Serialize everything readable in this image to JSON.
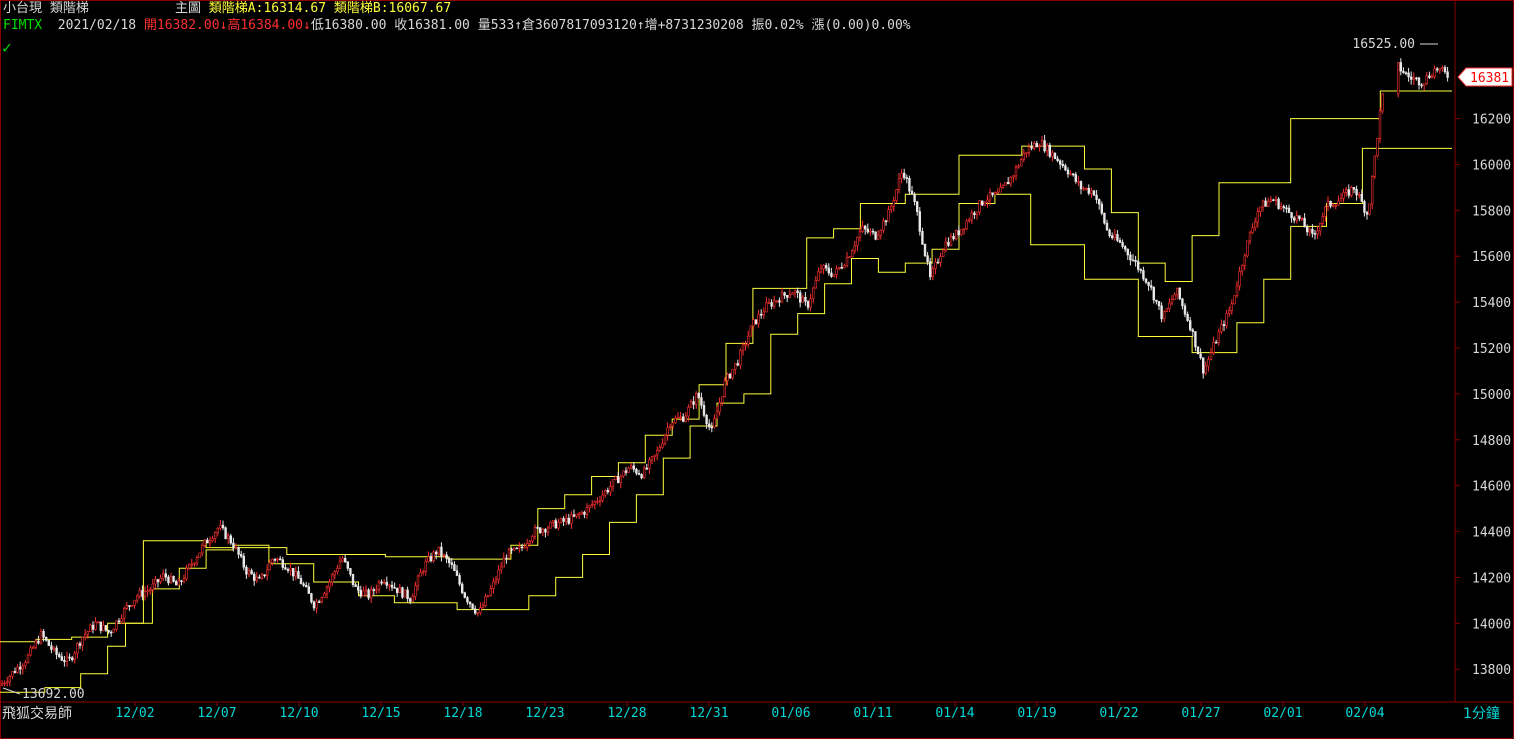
{
  "header": {
    "instrument": "小台現",
    "indicator": "類階梯",
    "pane": "主圖",
    "ladderA": "類階梯A:16314.67",
    "ladderB": "類階梯B:16067.67"
  },
  "quote": {
    "symbol": "FIMTX",
    "date": "2021/02/18",
    "open": "開16382.00",
    "open_arrow": "↓",
    "high": "高16384.00",
    "high_arrow": "↓",
    "low": "低16380.00",
    "close": "收16381.00",
    "volume": "量533",
    "oi_arrow": "↑",
    "open_interest": "倉3607817093120",
    "change_arrow": "↑",
    "change": "增+8731230208",
    "amplitude": "振0.02%",
    "rise": "漲(0.00)0.00%"
  },
  "footer": {
    "vendor": "飛狐交易師",
    "period": "1分鐘"
  },
  "colors": {
    "background": "#000000",
    "border": "#8b0000",
    "ladder": "#ffff3c",
    "candle_up": "#ff3030",
    "candle_down": "#e8e8e8",
    "axis_text": "#00d8d8"
  },
  "chart_data": {
    "type": "candlestick",
    "ylim": [
      13650,
      16650
    ],
    "yticks": [
      "13800",
      "14000",
      "14200",
      "14400",
      "14600",
      "14800",
      "15000",
      "15200",
      "15400",
      "15600",
      "15800",
      "16000",
      "16200"
    ],
    "xticks": [
      "12/02",
      "12/07",
      "12/10",
      "12/15",
      "12/18",
      "12/23",
      "12/28",
      "12/31",
      "01/06",
      "01/11",
      "01/14",
      "01/19",
      "01/22",
      "01/27",
      "02/01",
      "02/04"
    ],
    "last_price": "16381",
    "high_label": "16525.00",
    "low_label": "13692.00",
    "price_path": [
      13730,
      13790,
      13850,
      13950,
      13870,
      13830,
      13940,
      14000,
      13960,
      14050,
      14120,
      14150,
      14210,
      14160,
      14260,
      14350,
      14420,
      14350,
      14230,
      14180,
      14290,
      14250,
      14180,
      14080,
      14170,
      14290,
      14150,
      14120,
      14200,
      14150,
      14110,
      14250,
      14320,
      14250,
      14120,
      14040,
      14160,
      14300,
      14320,
      14400,
      14420,
      14440,
      14460,
      14500,
      14560,
      14620,
      14680,
      14650,
      14740,
      14880,
      14900,
      15000,
      14830,
      15050,
      15150,
      15300,
      15380,
      15420,
      15450,
      15380,
      15550,
      15520,
      15600,
      15720,
      15690,
      15790,
      15980,
      15800,
      15500,
      15650,
      15700,
      15780,
      15850,
      15870,
      15950,
      16060,
      16100,
      16040,
      15980,
      15900,
      15880,
      15700,
      15650,
      15570,
      15480,
      15330,
      15450,
      15300,
      15100,
      15250,
      15380,
      15620,
      15810,
      15850,
      15800,
      15760,
      15680,
      15820,
      15850,
      15900,
      15780,
      16280,
      16440,
      16380,
      16360,
      16420,
      16381
    ],
    "ladder_A": [
      [
        0,
        13920
      ],
      [
        4,
        13920
      ],
      [
        4,
        13930
      ],
      [
        8,
        13930
      ],
      [
        8,
        13940
      ],
      [
        12,
        13940
      ],
      [
        12,
        14000
      ],
      [
        16,
        14000
      ],
      [
        16,
        14360
      ],
      [
        23,
        14360
      ],
      [
        23,
        14330
      ],
      [
        32,
        14330
      ],
      [
        32,
        14300
      ],
      [
        43,
        14300
      ],
      [
        43,
        14290
      ],
      [
        50,
        14290
      ],
      [
        50,
        14280
      ],
      [
        57,
        14280
      ],
      [
        57,
        14340
      ],
      [
        60,
        14340
      ],
      [
        60,
        14500
      ],
      [
        63,
        14500
      ],
      [
        63,
        14560
      ],
      [
        66,
        14560
      ],
      [
        66,
        14640
      ],
      [
        69,
        14640
      ],
      [
        69,
        14700
      ],
      [
        72,
        14700
      ],
      [
        72,
        14820
      ],
      [
        75,
        14820
      ],
      [
        75,
        14890
      ],
      [
        78,
        14890
      ],
      [
        78,
        15040
      ],
      [
        81,
        15040
      ],
      [
        81,
        15220
      ],
      [
        84,
        15220
      ],
      [
        84,
        15460
      ],
      [
        90,
        15460
      ],
      [
        90,
        15680
      ],
      [
        93,
        15680
      ],
      [
        93,
        15720
      ],
      [
        96,
        15720
      ],
      [
        96,
        15830
      ],
      [
        101,
        15830
      ],
      [
        101,
        15870
      ],
      [
        107,
        15870
      ],
      [
        107,
        16040
      ],
      [
        114,
        16040
      ],
      [
        114,
        16080
      ],
      [
        121,
        16080
      ],
      [
        121,
        15980
      ],
      [
        124,
        15980
      ],
      [
        124,
        15790
      ],
      [
        127,
        15790
      ],
      [
        127,
        15570
      ],
      [
        130,
        15570
      ],
      [
        130,
        15490
      ],
      [
        133,
        15490
      ],
      [
        133,
        15690
      ],
      [
        136,
        15690
      ],
      [
        136,
        15920
      ],
      [
        144,
        15920
      ],
      [
        144,
        16200
      ],
      [
        154,
        16200
      ],
      [
        154,
        16320
      ],
      [
        162,
        16320
      ]
    ],
    "ladder_B": [
      [
        0,
        13700
      ],
      [
        5,
        13700
      ],
      [
        5,
        13720
      ],
      [
        9,
        13720
      ],
      [
        9,
        13780
      ],
      [
        12,
        13780
      ],
      [
        12,
        13900
      ],
      [
        14,
        13900
      ],
      [
        14,
        14000
      ],
      [
        17,
        14000
      ],
      [
        17,
        14150
      ],
      [
        20,
        14150
      ],
      [
        20,
        14240
      ],
      [
        23,
        14240
      ],
      [
        23,
        14320
      ],
      [
        26,
        14320
      ],
      [
        26,
        14340
      ],
      [
        30,
        14340
      ],
      [
        30,
        14260
      ],
      [
        35,
        14260
      ],
      [
        35,
        14180
      ],
      [
        40,
        14180
      ],
      [
        40,
        14120
      ],
      [
        44,
        14120
      ],
      [
        44,
        14090
      ],
      [
        51,
        14090
      ],
      [
        51,
        14060
      ],
      [
        59,
        14060
      ],
      [
        59,
        14120
      ],
      [
        62,
        14120
      ],
      [
        62,
        14200
      ],
      [
        65,
        14200
      ],
      [
        65,
        14300
      ],
      [
        68,
        14300
      ],
      [
        68,
        14440
      ],
      [
        71,
        14440
      ],
      [
        71,
        14560
      ],
      [
        74,
        14560
      ],
      [
        74,
        14720
      ],
      [
        77,
        14720
      ],
      [
        77,
        14860
      ],
      [
        80,
        14860
      ],
      [
        80,
        14960
      ],
      [
        83,
        14960
      ],
      [
        83,
        15000
      ],
      [
        86,
        15000
      ],
      [
        86,
        15260
      ],
      [
        89,
        15260
      ],
      [
        89,
        15350
      ],
      [
        92,
        15350
      ],
      [
        92,
        15480
      ],
      [
        95,
        15480
      ],
      [
        95,
        15590
      ],
      [
        98,
        15590
      ],
      [
        98,
        15530
      ],
      [
        101,
        15530
      ],
      [
        101,
        15570
      ],
      [
        104,
        15570
      ],
      [
        104,
        15630
      ],
      [
        107,
        15630
      ],
      [
        107,
        15830
      ],
      [
        111,
        15830
      ],
      [
        111,
        15870
      ],
      [
        115,
        15870
      ],
      [
        115,
        15650
      ],
      [
        121,
        15650
      ],
      [
        121,
        15500
      ],
      [
        127,
        15500
      ],
      [
        127,
        15250
      ],
      [
        133,
        15250
      ],
      [
        133,
        15180
      ],
      [
        138,
        15180
      ],
      [
        138,
        15310
      ],
      [
        141,
        15310
      ],
      [
        141,
        15500
      ],
      [
        144,
        15500
      ],
      [
        144,
        15730
      ],
      [
        148,
        15730
      ],
      [
        148,
        15830
      ],
      [
        152,
        15830
      ],
      [
        152,
        16070
      ],
      [
        162,
        16070
      ]
    ]
  }
}
